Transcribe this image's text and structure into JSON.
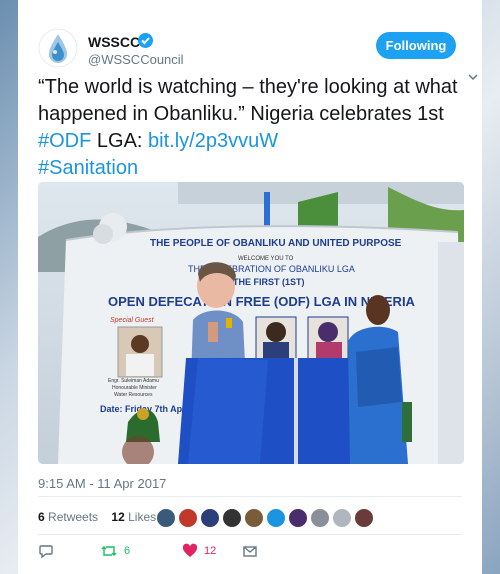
{
  "tweet": {
    "display_name": "WSSCC",
    "handle": "@WSSCCouncil",
    "follow_label": "Following",
    "text_plain_1": "“The world is watching – they're looking at what happened in Obanliku.” Nigeria celebrates 1st ",
    "hashtag_odf": "#ODF",
    "text_plain_2": " LGA: ",
    "link": "bit.ly/2p3vvuW",
    "hashtag_sanitation": "#Sanitation",
    "timestamp": "9:15 AM - 11 Apr 2017",
    "retweets_count": "6",
    "retweets_label": "Retweets",
    "likes_count": "12",
    "likes_label": "Likes",
    "actions": {
      "retweet_count": "6",
      "like_count": "12"
    }
  },
  "photo_banner": {
    "line1": "THE PEOPLE OF OBANLIKU AND UNITED PURPOSE",
    "line2": "WELCOME YOU TO",
    "line3": "THE CELEBRATION OF OBANLIKU LGA",
    "line4": "AS THE FIRST (1ST)",
    "line5": "OPEN DEFECATION FREE (ODF) LGA IN NIGERIA",
    "special_guest": "Special Guest",
    "guest_name": "Engr. Suleiman Adamu",
    "guest_title": "Honourable Minister",
    "guest_ministry": "Water Resources",
    "date_label": "Date: Friday 7th April"
  },
  "colors": {
    "accent": "#1da1f2",
    "link": "#1b95e0",
    "like": "#e0245e",
    "retweet": "#17bf63",
    "muted": "#657786"
  },
  "icons": [
    "verified-icon",
    "chevron-down-icon",
    "reply-icon",
    "retweet-icon",
    "heart-icon",
    "dm-icon"
  ]
}
